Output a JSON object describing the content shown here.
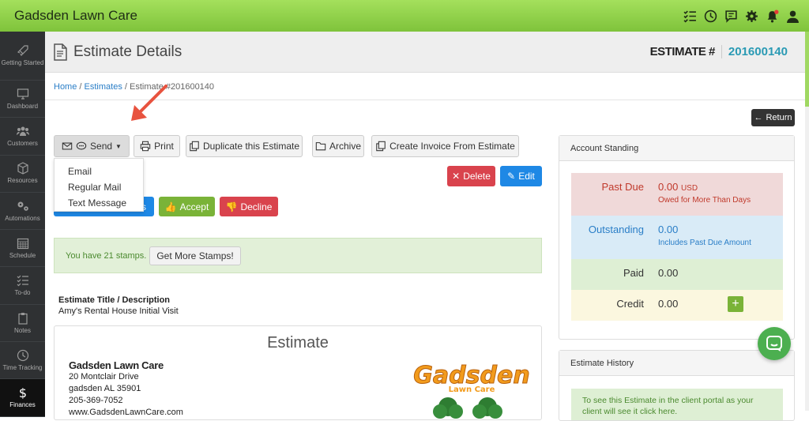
{
  "app": {
    "title": "Gadsden Lawn Care"
  },
  "topbar": {
    "icons": [
      "checklist-icon",
      "clock-icon",
      "chat-icon",
      "gear-icon",
      "bell-icon",
      "user-icon"
    ]
  },
  "sidebar": {
    "items": [
      {
        "label": "Getting Started",
        "icon": "rocket-icon"
      },
      {
        "label": "Dashboard",
        "icon": "monitor-icon"
      },
      {
        "label": "Customers",
        "icon": "users-icon"
      },
      {
        "label": "Resources",
        "icon": "box-icon"
      },
      {
        "label": "Automations",
        "icon": "gears-icon"
      },
      {
        "label": "Schedule",
        "icon": "calendar-icon"
      },
      {
        "label": "To-do",
        "icon": "list-icon"
      },
      {
        "label": "Notes",
        "icon": "clipboard-icon"
      },
      {
        "label": "Time Tracking",
        "icon": "clock-icon"
      },
      {
        "label": "Finances",
        "icon": "dollar-icon"
      }
    ]
  },
  "header": {
    "title": "Estimate Details",
    "estimate_label": "ESTIMATE #",
    "estimate_number": "201600140"
  },
  "breadcrumb": {
    "home": "Home",
    "estimates": "Estimates",
    "current": "Estimate #201600140"
  },
  "actions": {
    "return": "Return",
    "send": "Send",
    "print": "Print",
    "duplicate": "Duplicate this Estimate",
    "archive": "Archive",
    "create_invoice": "Create Invoice From Estimate",
    "delete": "Delete",
    "edit": "Edit",
    "accept": "Accept",
    "decline": "Decline"
  },
  "send_menu": {
    "items": [
      "Email",
      "Regular Mail",
      "Text Message"
    ]
  },
  "stamps": {
    "message": "You have 21 stamps.",
    "button": "Get More Stamps!"
  },
  "estimate": {
    "desc_label": "Estimate Title / Description",
    "desc_value": "Amy's Rental House Initial Visit",
    "heading": "Estimate",
    "company": {
      "name": "Gadsden Lawn Care",
      "address1": "20 Montclair Drive",
      "address2": "gadsden AL 35901",
      "phone": "205-369-7052",
      "website": "www.GadsdenLawnCare.com"
    },
    "logo_text": {
      "line1": "Gadsden",
      "line2": "Lawn Care"
    }
  },
  "account_standing": {
    "title": "Account Standing",
    "rows": [
      {
        "label": "Past Due",
        "value": "0.00",
        "currency": "USD",
        "note": "Owed for More Than Days"
      },
      {
        "label": "Outstanding",
        "value": "0.00",
        "note": "Includes Past Due Amount"
      },
      {
        "label": "Paid",
        "value": "0.00"
      },
      {
        "label": "Credit",
        "value": "0.00",
        "add": "+"
      }
    ]
  },
  "history": {
    "title": "Estimate History",
    "note": "To see this Estimate in the client portal as your client will see it click here."
  },
  "colors": {
    "brand_green": "#7fc33b",
    "accent_blue": "#2a9ab4",
    "danger": "#d9434d",
    "primary": "#1e88e5"
  }
}
